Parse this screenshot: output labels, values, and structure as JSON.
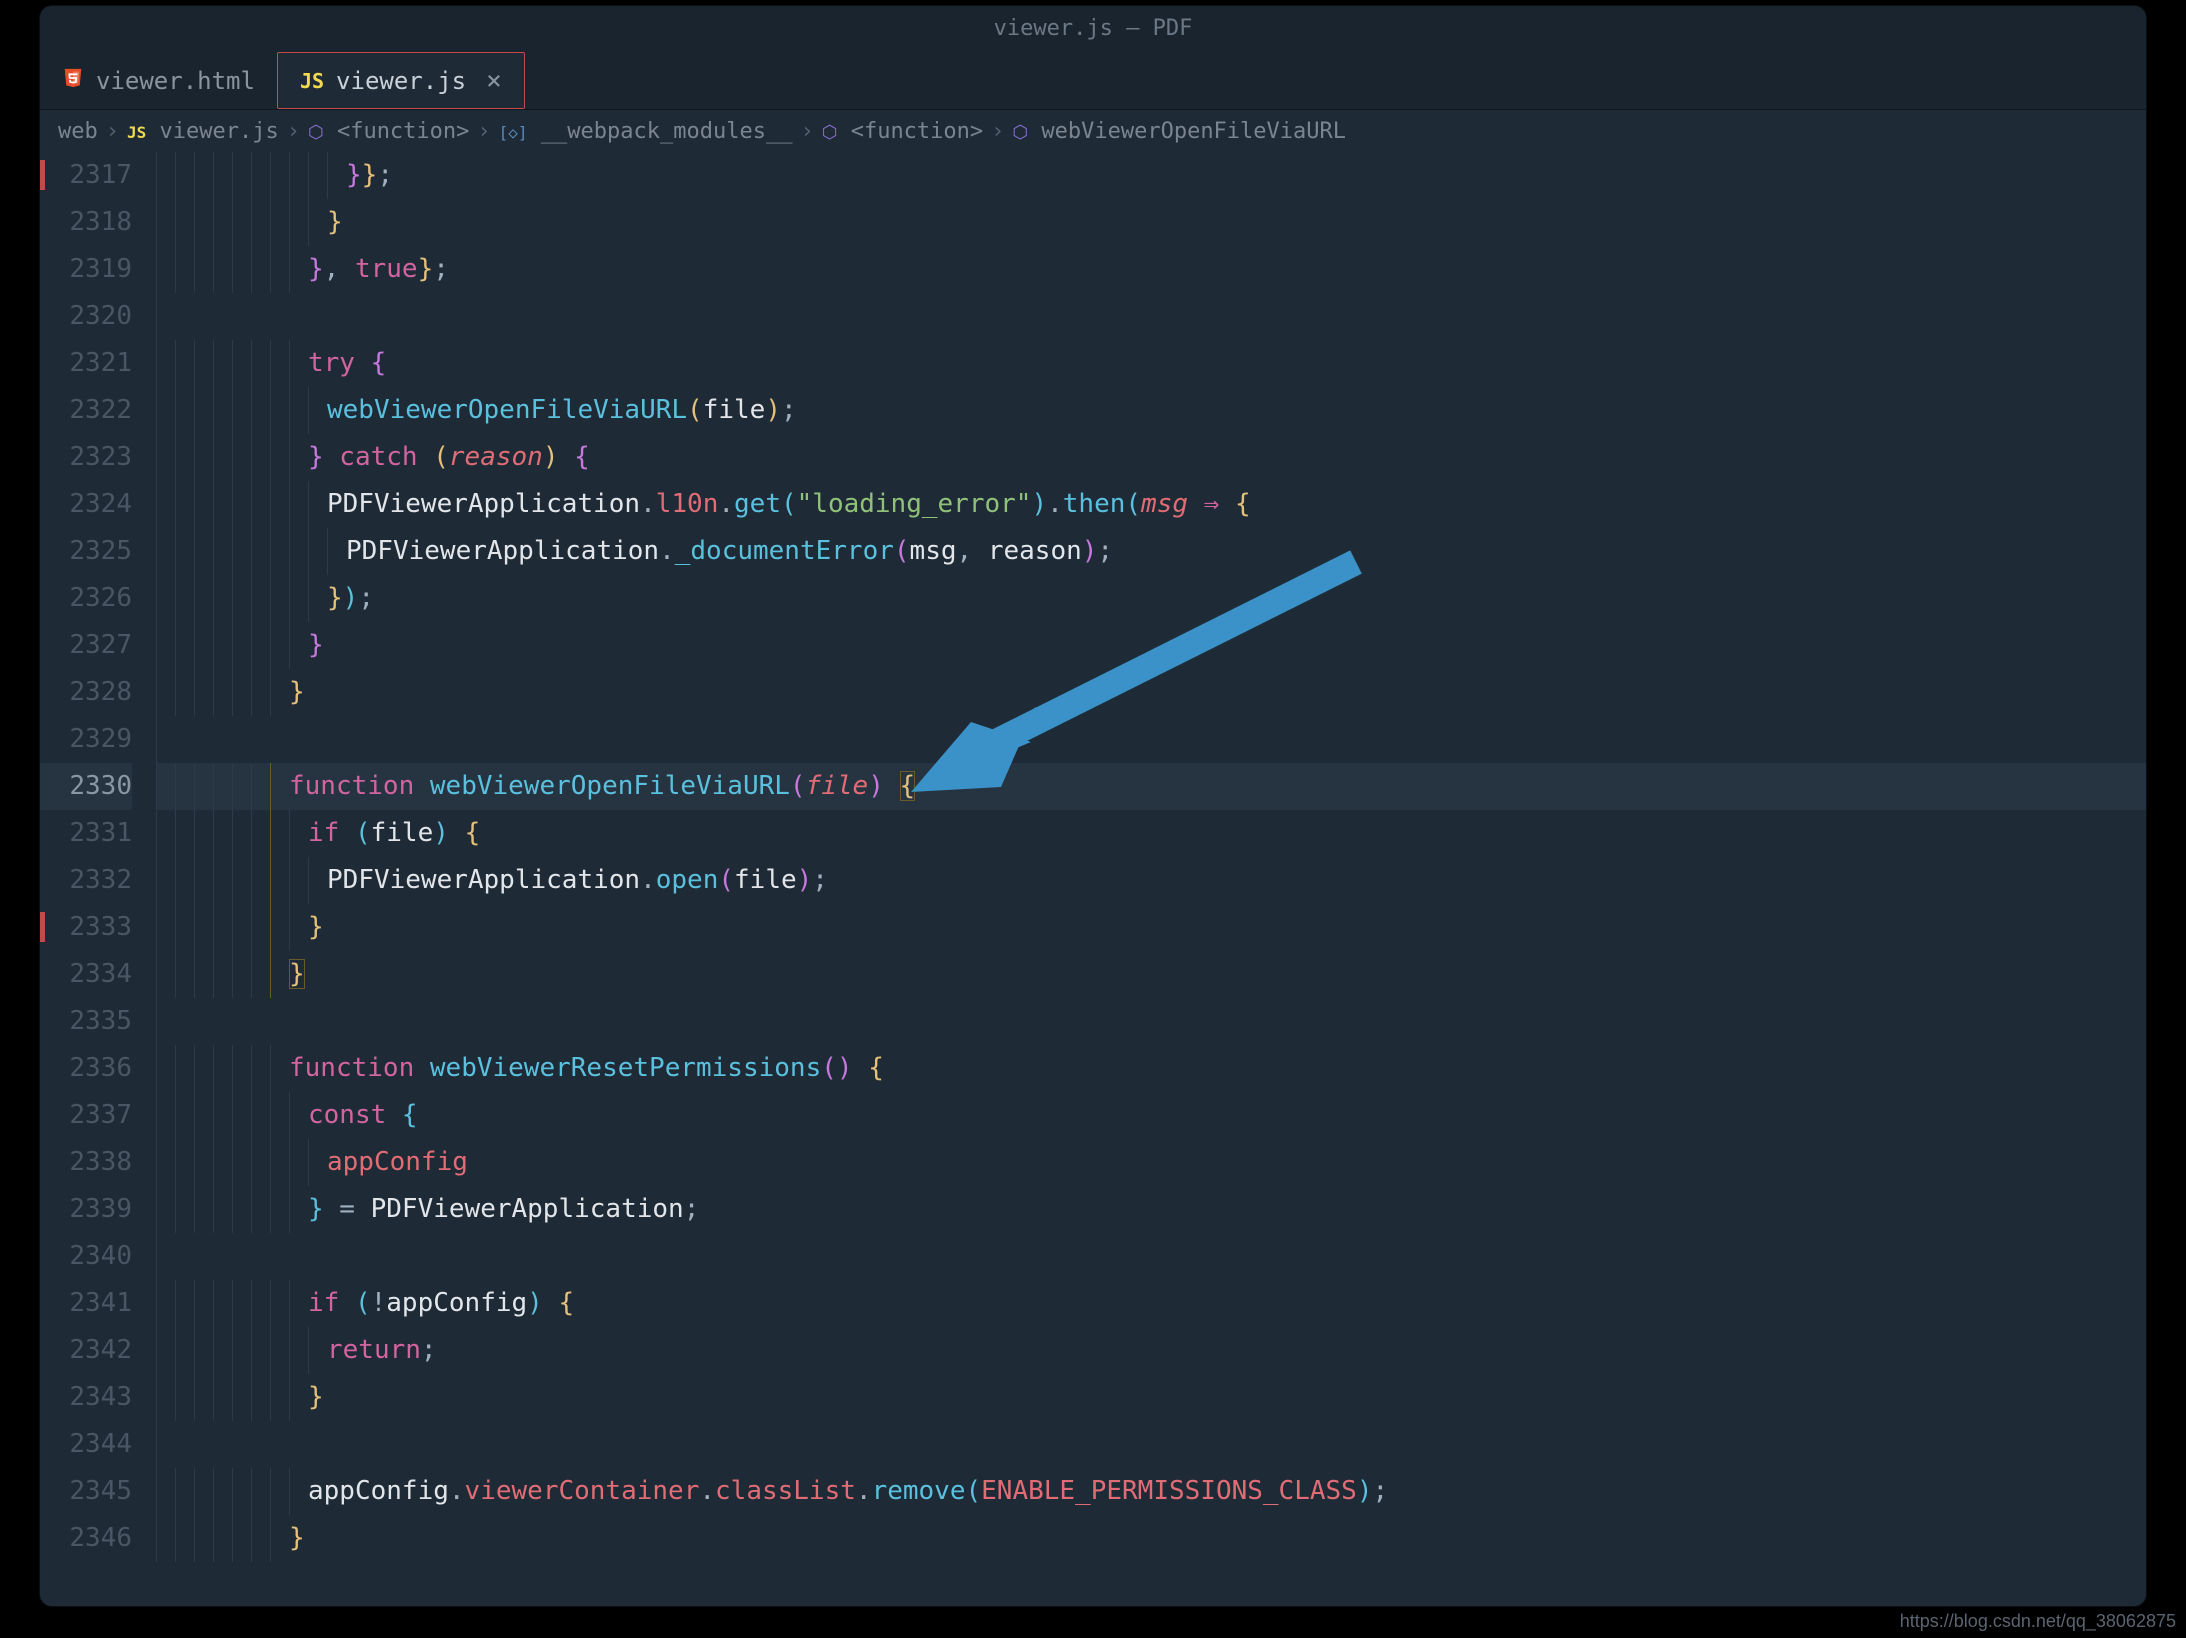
{
  "titlebar": "viewer.js — PDF",
  "tabs": [
    {
      "icon": "html5",
      "label": "viewer.html",
      "active": false
    },
    {
      "icon": "js",
      "label": "viewer.js",
      "active": true
    }
  ],
  "breadcrumb": {
    "parts": [
      {
        "kind": "folder",
        "text": "web"
      },
      {
        "kind": "js",
        "text": "viewer.js"
      },
      {
        "kind": "cube",
        "text": "<function>"
      },
      {
        "kind": "bracket",
        "text": "__webpack_modules__"
      },
      {
        "kind": "cube",
        "text": "<function>"
      },
      {
        "kind": "cube",
        "text": "webViewerOpenFileViaURL"
      }
    ]
  },
  "line_start": 2317,
  "line_end": 2346,
  "current_line": 2330,
  "red_marks": [
    2317,
    2333
  ],
  "code_tokens": {
    "2317": [
      [
        "indent",
        10
      ],
      [
        "brace-m",
        "}"
      ],
      [
        "brace",
        "}"
      ],
      [
        "punct",
        ";"
      ]
    ],
    "2318": [
      [
        "indent",
        9
      ],
      [
        "brace",
        "}"
      ]
    ],
    "2319": [
      [
        "indent",
        8
      ],
      [
        "brace-m",
        "}"
      ],
      [
        "punct",
        ", "
      ],
      [
        "keyword",
        "true"
      ],
      [
        "brace",
        "}"
      ],
      [
        "punct",
        ";"
      ]
    ],
    "2320": [
      [
        "indent",
        0
      ]
    ],
    "2321": [
      [
        "indent",
        8
      ],
      [
        "keyword",
        "try "
      ],
      [
        "brace-m",
        "{"
      ]
    ],
    "2322": [
      [
        "indent",
        9
      ],
      [
        "call",
        "webViewerOpenFileViaURL"
      ],
      [
        "brace",
        "("
      ],
      [
        "ident",
        "file"
      ],
      [
        "brace",
        ")"
      ],
      [
        "punct",
        ";"
      ]
    ],
    "2323": [
      [
        "indent",
        8
      ],
      [
        "brace-m",
        "}"
      ],
      [
        "keyword",
        " catch "
      ],
      [
        "brace",
        "("
      ],
      [
        "param",
        "reason"
      ],
      [
        "brace",
        ") "
      ],
      [
        "brace-m",
        "{"
      ]
    ],
    "2324": [
      [
        "indent",
        9
      ],
      [
        "obj",
        "PDFViewerApplication"
      ],
      [
        "punct",
        "."
      ],
      [
        "prop",
        "l10n"
      ],
      [
        "punct",
        "."
      ],
      [
        "call",
        "get"
      ],
      [
        "brace-o",
        "("
      ],
      [
        "string",
        "\"loading_error\""
      ],
      [
        "brace-o",
        ")"
      ],
      [
        "punct",
        "."
      ],
      [
        "call",
        "then"
      ],
      [
        "brace-o",
        "("
      ],
      [
        "param",
        "msg"
      ],
      [
        "punct",
        " "
      ],
      [
        "arrow",
        "⇒"
      ],
      [
        "punct",
        " "
      ],
      [
        "brace",
        "{"
      ]
    ],
    "2325": [
      [
        "indent",
        10
      ],
      [
        "obj",
        "PDFViewerApplication"
      ],
      [
        "punct",
        "."
      ],
      [
        "call",
        "_documentError"
      ],
      [
        "brace-m",
        "("
      ],
      [
        "ident",
        "msg"
      ],
      [
        "punct",
        ", "
      ],
      [
        "ident",
        "reason"
      ],
      [
        "brace-m",
        ")"
      ],
      [
        "punct",
        ";"
      ]
    ],
    "2326": [
      [
        "indent",
        9
      ],
      [
        "brace",
        "}"
      ],
      [
        "brace-o",
        ")"
      ],
      [
        "punct",
        ";"
      ]
    ],
    "2327": [
      [
        "indent",
        8
      ],
      [
        "brace-m",
        "}"
      ]
    ],
    "2328": [
      [
        "indent",
        7
      ],
      [
        "brace",
        "}"
      ]
    ],
    "2329": [
      [
        "indent",
        0
      ]
    ],
    "2330": [
      [
        "indent",
        7,
        "hl"
      ],
      [
        "keyword",
        "function "
      ],
      [
        "func",
        "webViewerOpenFileViaURL"
      ],
      [
        "brace-m",
        "("
      ],
      [
        "param",
        "file"
      ],
      [
        "brace-m",
        ") "
      ],
      [
        "brace-hl",
        "{"
      ]
    ],
    "2331": [
      [
        "indent",
        8,
        "hl"
      ],
      [
        "keyword",
        "if "
      ],
      [
        "brace-o",
        "("
      ],
      [
        "ident",
        "file"
      ],
      [
        "brace-o",
        ") "
      ],
      [
        "brace",
        "{"
      ]
    ],
    "2332": [
      [
        "indent",
        9,
        "hl"
      ],
      [
        "obj",
        "PDFViewerApplication"
      ],
      [
        "punct",
        "."
      ],
      [
        "call",
        "open"
      ],
      [
        "brace-m",
        "("
      ],
      [
        "ident",
        "file"
      ],
      [
        "brace-m",
        ")"
      ],
      [
        "punct",
        ";"
      ]
    ],
    "2333": [
      [
        "indent",
        8,
        "hl"
      ],
      [
        "brace",
        "}"
      ]
    ],
    "2334": [
      [
        "indent",
        7,
        "hl"
      ],
      [
        "brace-hl",
        "}"
      ]
    ],
    "2335": [
      [
        "indent",
        0
      ]
    ],
    "2336": [
      [
        "indent",
        7
      ],
      [
        "keyword",
        "function "
      ],
      [
        "func",
        "webViewerResetPermissions"
      ],
      [
        "brace-m",
        "("
      ],
      [
        "brace-m",
        ") "
      ],
      [
        "brace",
        "{"
      ]
    ],
    "2337": [
      [
        "indent",
        8
      ],
      [
        "keyword",
        "const "
      ],
      [
        "brace-o",
        "{"
      ]
    ],
    "2338": [
      [
        "indent",
        9
      ],
      [
        "prop",
        "appConfig"
      ]
    ],
    "2339": [
      [
        "indent",
        8
      ],
      [
        "brace-o",
        "}"
      ],
      [
        "punct",
        " = "
      ],
      [
        "obj",
        "PDFViewerApplication"
      ],
      [
        "punct",
        ";"
      ]
    ],
    "2340": [
      [
        "indent",
        0
      ]
    ],
    "2341": [
      [
        "indent",
        8
      ],
      [
        "keyword",
        "if "
      ],
      [
        "brace-o",
        "("
      ],
      [
        "punct",
        "!"
      ],
      [
        "ident",
        "appConfig"
      ],
      [
        "brace-o",
        ") "
      ],
      [
        "brace",
        "{"
      ]
    ],
    "2342": [
      [
        "indent",
        9
      ],
      [
        "keyword",
        "return"
      ],
      [
        "punct",
        ";"
      ]
    ],
    "2343": [
      [
        "indent",
        8
      ],
      [
        "brace",
        "}"
      ]
    ],
    "2344": [
      [
        "indent",
        0
      ]
    ],
    "2345": [
      [
        "indent",
        8
      ],
      [
        "ident",
        "appConfig"
      ],
      [
        "punct",
        "."
      ],
      [
        "prop",
        "viewerContainer"
      ],
      [
        "punct",
        "."
      ],
      [
        "prop",
        "classList"
      ],
      [
        "punct",
        "."
      ],
      [
        "call",
        "remove"
      ],
      [
        "brace-o",
        "("
      ],
      [
        "const",
        "ENABLE_PERMISSIONS_CLASS"
      ],
      [
        "brace-o",
        ")"
      ],
      [
        "punct",
        ";"
      ]
    ],
    "2346": [
      [
        "indent",
        7
      ],
      [
        "brace",
        "}"
      ]
    ]
  },
  "watermark": "https://blog.csdn.net/qq_38062875"
}
